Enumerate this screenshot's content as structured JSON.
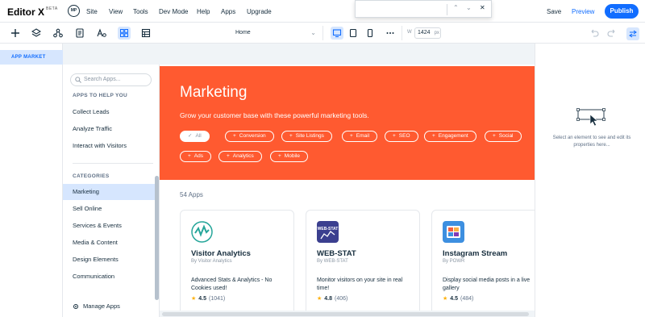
{
  "app": {
    "logo": "Editor X",
    "logo_badge": "BETA",
    "site_avatar": "MP"
  },
  "menu": [
    "Site",
    "View",
    "Tools",
    "Dev Mode",
    "Help",
    "Apps",
    "Upgrade"
  ],
  "topbar_actions": {
    "save": "Save",
    "preview": "Preview",
    "publish": "Publish"
  },
  "toolbar": {
    "page_select": "Home",
    "width_label": "W",
    "width_value": "1424",
    "width_unit": "px",
    "icons": [
      "add-icon",
      "layers-icon",
      "connect-icon",
      "pages-icon",
      "text-style-icon",
      "grid-icon",
      "table-icon",
      "desktop-icon",
      "tablet-icon",
      "mobile-icon",
      "more-icon",
      "undo-icon",
      "redo-icon",
      "inspector-toggle-icon"
    ]
  },
  "left_panel": {
    "tab": "APP MARKET"
  },
  "sidebar": {
    "search_placeholder": "Search Apps...",
    "help_title": "APPS TO HELP YOU",
    "help_items": [
      "Collect Leads",
      "Analyze Traffic",
      "Interact with Visitors"
    ],
    "categories_title": "CATEGORIES",
    "categories": [
      "Marketing",
      "Sell Online",
      "Services & Events",
      "Media & Content",
      "Design Elements",
      "Communication"
    ],
    "active_category": "Marketing",
    "manage_apps": "Manage Apps"
  },
  "hero": {
    "title": "Marketing",
    "subtitle": "Grow your customer base with these powerful marketing tools.",
    "filters": [
      "All",
      "Conversion",
      "Site Listings",
      "Email",
      "SEO",
      "Engagement",
      "Social",
      "Ads",
      "Analytics",
      "Mobile"
    ],
    "active_filter": "All",
    "color": "#ff5a30"
  },
  "apps_count": "54 Apps",
  "apps": [
    {
      "name": "Visitor Analytics",
      "by": "By Visitor Analytics",
      "desc": "Advanced Stats & Analytics - No Cookies used!",
      "rating": "4.5",
      "reviews": "(1041)"
    },
    {
      "name": "WEB-STAT",
      "by": "By WEB-STAT",
      "desc": "Monitor visitors on your site in real time!",
      "rating": "4.8",
      "reviews": "(406)"
    },
    {
      "name": "Instagram Stream",
      "by": "By POWR",
      "desc": "Display social media posts in a live gallery",
      "rating": "4.5",
      "reviews": "(484)"
    }
  ],
  "webstat_icon_text": "WEB-STAT",
  "inspector": {
    "message": "Select an element to see and edit its properties here..."
  },
  "popup": {
    "up": "⌃",
    "down": "⌄",
    "close": "✕"
  },
  "colors": {
    "accent": "#116dff",
    "selection": "#d6e6fe",
    "star": "#fdb10c"
  }
}
